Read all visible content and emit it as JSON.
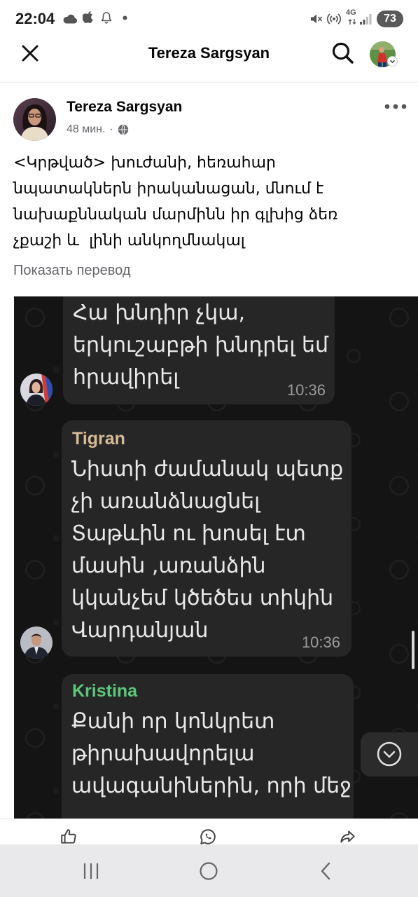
{
  "status_bar": {
    "time": "22:04",
    "network_type": "4G",
    "battery_percent": "73",
    "icons": [
      "cloud-icon",
      "apple-icon",
      "notification-bell-icon",
      "dot-icon",
      "mute-icon",
      "hotspot-icon",
      "network-arrows-icon",
      "signal-icon",
      "battery-icon"
    ]
  },
  "header": {
    "title": "Tereza Sargsyan",
    "icons": [
      "close-icon",
      "search-icon",
      "profile-avatar",
      "chevron-down-icon"
    ]
  },
  "post": {
    "author": "Tereza Sargsyan",
    "time": "48 мин.",
    "separator": "·",
    "icons": [
      "globe-icon",
      "more-dots-icon"
    ],
    "text_lines": [
      "<Կրթված> խուժանի, հեռահար",
      "նպատակներն իրականացան, մնում է",
      "նախաքննական մարմինն իր գլխից ձեռ",
      "չքաշի և  լինի անկողմնակալ"
    ],
    "translate_link": "Показать перевод",
    "image": {
      "messages": [
        {
          "lines": [
            "Հա խնդիր չկա,",
            "երկուշաբթի խնդրել եմ",
            "հրավիրել"
          ],
          "time": "10:36"
        },
        {
          "sender": "Tigran",
          "sender_color": "#d6bb95",
          "lines": [
            "Նիստի ժամանակ պետք",
            "չի առանձնացնել",
            "Տաթևին ու խոսել էտ",
            "մասին ,առանձին",
            "կկանչեմ կծեծես տիկին",
            "Վարդանյան"
          ],
          "time": "10:36"
        },
        {
          "sender": "Kristina",
          "sender_color": "#5cc77b",
          "lines": [
            "Քանի որ կոնկրետ",
            "թիրախավորելա",
            "ավագանիներին, որի մեջ"
          ]
        }
      ],
      "icons": [
        "chevron-down-circle-icon"
      ]
    }
  },
  "actions": {
    "icons": [
      "thumbs-up-icon",
      "whatsapp-icon",
      "share-icon"
    ]
  },
  "nav_bar": {
    "icons": [
      "recent-apps-icon",
      "home-icon",
      "back-icon"
    ]
  },
  "colors": {
    "text_primary": "#050505",
    "text_secondary": "#65676b",
    "chat_background": "#141414",
    "chat_bubble": "#262626",
    "chat_text": "#e9e9e9",
    "chat_time": "#9b9b9b",
    "nav_bar": "#e9e9eb"
  }
}
